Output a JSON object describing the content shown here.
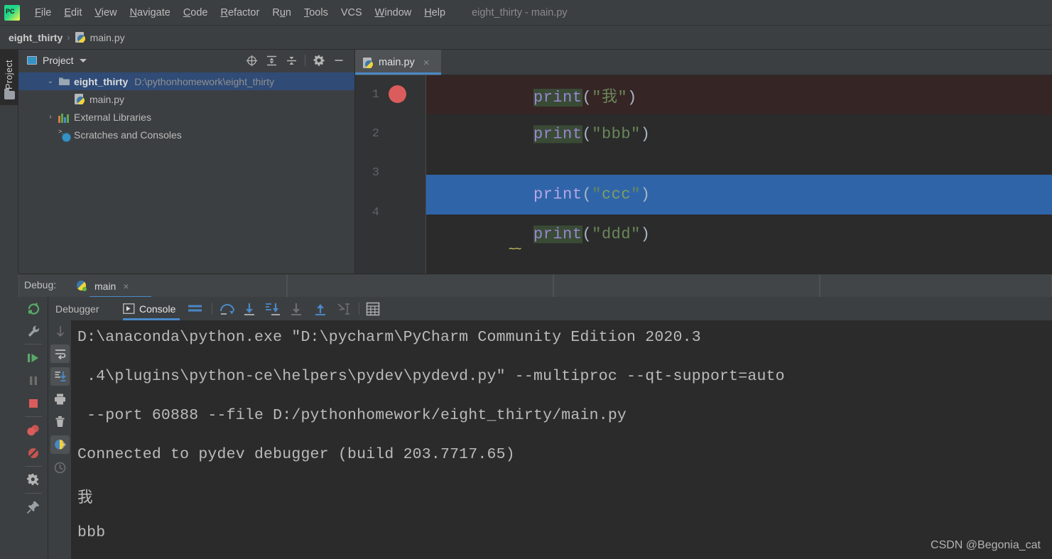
{
  "window": {
    "title": "eight_thirty - main.py",
    "app_logo": "pycharm-logo"
  },
  "menubar": {
    "items": [
      {
        "label": "File",
        "mnemonic": "F"
      },
      {
        "label": "Edit",
        "mnemonic": "E"
      },
      {
        "label": "View",
        "mnemonic": "V"
      },
      {
        "label": "Navigate",
        "mnemonic": "N"
      },
      {
        "label": "Code",
        "mnemonic": "C"
      },
      {
        "label": "Refactor",
        "mnemonic": "R"
      },
      {
        "label": "Run",
        "mnemonic": "u"
      },
      {
        "label": "Tools",
        "mnemonic": "T"
      },
      {
        "label": "VCS",
        "mnemonic": ""
      },
      {
        "label": "Window",
        "mnemonic": "W"
      },
      {
        "label": "Help",
        "mnemonic": "H"
      }
    ]
  },
  "breadcrumb": {
    "project": "eight_thirty",
    "separator": "›",
    "file": "main.py"
  },
  "left_strip": {
    "tool_tab": "Project"
  },
  "project_panel": {
    "title": "Project",
    "toolbar": [
      {
        "name": "select-opened-file-icon",
        "label": "Select Opened File"
      },
      {
        "name": "expand-all-icon",
        "label": "Expand All"
      },
      {
        "name": "collapse-all-icon",
        "label": "Collapse All"
      },
      {
        "name": "gear-icon",
        "label": "Options"
      },
      {
        "name": "hide-icon",
        "label": "Hide"
      }
    ],
    "tree": [
      {
        "label": "eight_thirty",
        "path": "D:\\pythonhomework\\eight_thirty",
        "icon": "folder-icon",
        "arrow": "⌄",
        "expanded": true,
        "selected": true,
        "indent": 0
      },
      {
        "label": "main.py",
        "path": "",
        "icon": "python-file-icon",
        "arrow": "",
        "expanded": false,
        "selected": false,
        "indent": 1
      },
      {
        "label": "External Libraries",
        "path": "",
        "icon": "library-icon",
        "arrow": "›",
        "expanded": false,
        "selected": false,
        "indent": 0
      },
      {
        "label": "Scratches and Consoles",
        "path": "",
        "icon": "scratches-icon",
        "arrow": "",
        "expanded": false,
        "selected": false,
        "indent": 0
      }
    ]
  },
  "editor": {
    "tab": {
      "label": "main.py",
      "icon": "python-file-icon",
      "close": "×"
    },
    "lines": [
      {
        "number": "1",
        "keyword": "print",
        "open": "(",
        "quote1": "\"",
        "string": "我",
        "quote2": "\"",
        "close": ")",
        "breakpoint": true,
        "executing": false
      },
      {
        "number": "2",
        "keyword": "print",
        "open": "(",
        "quote1": "\"",
        "string": "bbb",
        "quote2": "\"",
        "close": ")",
        "breakpoint": false,
        "executing": false
      },
      {
        "number": "3",
        "keyword": "print",
        "open": "(",
        "quote1": "\"",
        "string": "ccc",
        "quote2": "\"",
        "close": ")",
        "breakpoint": false,
        "executing": true
      },
      {
        "number": "4",
        "keyword": "print",
        "open": "(",
        "quote1": "\"",
        "string": "ddd",
        "quote2": "\"",
        "close": ")",
        "breakpoint": false,
        "executing": false,
        "squiggle": true
      }
    ]
  },
  "debug": {
    "header_label": "Debug:",
    "run_config": "main",
    "run_config_close": "×",
    "tabs": [
      {
        "label": "Debugger",
        "active": false
      },
      {
        "label": "Console",
        "active": true,
        "icon": "console-icon"
      }
    ],
    "toolbar_icons": [
      {
        "name": "soft-wrap-icon"
      },
      {
        "name": "show-running-icon"
      },
      {
        "name": "step-over-icon"
      },
      {
        "name": "step-into-icon"
      },
      {
        "name": "force-step-into-icon"
      },
      {
        "name": "step-out-icon"
      },
      {
        "name": "run-to-cursor-icon"
      },
      {
        "name": "evaluate-expression-icon"
      }
    ],
    "side_toolbar": [
      {
        "name": "rerun-icon"
      },
      {
        "name": "edit-configurations-icon"
      },
      {
        "name": "resume-program-icon"
      },
      {
        "name": "pause-program-icon"
      },
      {
        "name": "stop-icon"
      },
      {
        "name": "view-breakpoints-icon"
      },
      {
        "name": "mute-breakpoints-icon"
      },
      {
        "name": "settings-icon"
      },
      {
        "name": "pin-tab-icon"
      }
    ],
    "side_toolbar2": [
      {
        "name": "up-arrow-icon"
      },
      {
        "name": "down-arrow-icon"
      },
      {
        "name": "soft-wrap-lines-icon"
      },
      {
        "name": "scroll-to-end-icon"
      },
      {
        "name": "print-icon"
      },
      {
        "name": "clear-all-icon"
      },
      {
        "name": "python-console-icon"
      },
      {
        "name": "history-icon"
      }
    ]
  },
  "console": {
    "lines": [
      "D:\\anaconda\\python.exe \"D:\\pycharm\\PyCharm Community Edition 2020.3",
      " .4\\plugins\\python-ce\\helpers\\pydev\\pydevd.py\" --multiproc --qt-support=auto",
      " --port 60888 --file D:/pythonhomework/eight_thirty/main.py",
      "Connected to pydev debugger (build 203.7717.65)",
      "我",
      "bbb"
    ]
  },
  "watermark": "CSDN @Begonia_cat",
  "colors": {
    "accent_blue": "#4a88c7",
    "exec_line": "#2f65a8",
    "breakpoint_line": "#362525",
    "breakpoint_dot": "#db5c5c",
    "editor_bg": "#2b2b2b",
    "panel_bg": "#3c3f41",
    "selection_blue": "#2f4b76",
    "string_green": "#6a8759",
    "keyword_purple": "#9a85d4",
    "identifier_highlight": "#394b35"
  }
}
